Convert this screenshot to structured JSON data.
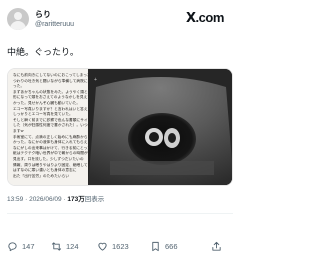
{
  "header": {
    "name": "らり",
    "handle": "@raritteruuu",
    "logo_text": ".com",
    "logo_mark": "X",
    "logo_mark_icon": "x-logo-icon"
  },
  "tweet": {
    "text": "中絶。ぐったり。"
  },
  "media": {
    "handwritten_lines": [
      "なにも前向きにしてないのにおこってしまった。",
      "つわりの吐き気と闘いながら準備して病院に向か",
      "った。",
      "まずあかちゃんの状態をみた。ようやく頭と体が",
      "形になって頭をおさえてのようなかしを見えた。可愛",
      "かった。見せかんぞ心臓も動いていた。",
      "エコー写真いりますか？と言われはいと答えた。",
      "しっかりとエコー写真を見ていた。",
      "そしと瞬く前までに診察で色んな書類にサインと印鑑を押",
      "した（気が狂感性何度で書かされた）。いつも通り",
      "ますw",
      "手術室にて、点滴の正しく始めにも麻酔から",
      "かった。なにかの液体も身体に入れてもらえなかった。",
      "なにがしの出来事はかけて、行きる前にとった口",
      "紙はテクテク暗い世界が中で朝からの時間が",
      "見出す。口を流した。少しずつだいたいの",
      "情報、周りは眠りやはりより固定、絶眠している",
      "はずなのに寒い濃いとも身体の意志に",
      "出た「出行苦労」のためたいらい"
    ]
  },
  "meta": {
    "time": "13:59",
    "separator": "·",
    "date": "2026/06/09",
    "views_count": "173万",
    "views_label": "回表示"
  },
  "actions": {
    "reply": {
      "icon": "reply-icon",
      "count": "147"
    },
    "retweet": {
      "icon": "retweet-icon",
      "count": "124"
    },
    "like": {
      "icon": "heart-icon",
      "count": "1623"
    },
    "bookmark": {
      "icon": "bookmark-icon",
      "count": "666"
    },
    "share": {
      "icon": "share-icon"
    }
  },
  "colors": {
    "text": "#0f1419",
    "secondary": "#536471",
    "divider": "#eff3f4",
    "ultrasound_bg": "#262626",
    "paper_bg": "#f4f2ee"
  }
}
